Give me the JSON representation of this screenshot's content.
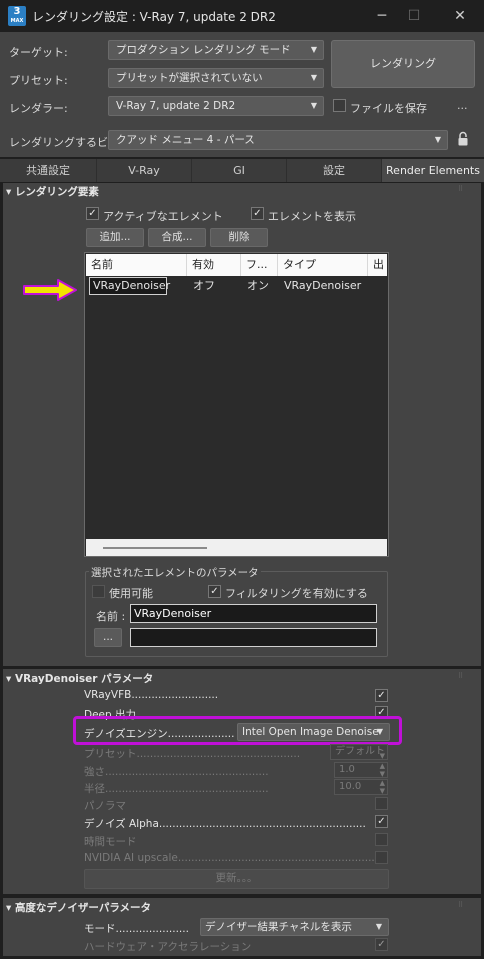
{
  "window": {
    "app_icon_text": "3",
    "app_icon_sub": "MAX",
    "title": "レンダリング設定 : V-Ray 7, update 2 DR2",
    "minimize": "─",
    "maximize": "☐",
    "close": "✕"
  },
  "top": {
    "target_label": "ターゲット:",
    "target_value": "プロダクション レンダリング モード",
    "preset_label": "プリセット:",
    "preset_value": "プリセットが選択されていない",
    "renderer_label": "レンダラー:",
    "renderer_value": "V-Ray 7, update 2 DR2",
    "render_button": "レンダリング",
    "save_file_label": "ファイルを保存",
    "save_file_checked": false,
    "more_button": "...",
    "view_label": "レンダリングするビュー:",
    "view_value": "クアッド メニュー 4 - パース"
  },
  "tabs": [
    "共通設定",
    "V-Ray",
    "GI",
    "設定",
    "Render Elements"
  ],
  "active_tab": "Render Elements",
  "render_elements": {
    "header": "レンダリング要素",
    "active_elements_label": "アクティブなエレメント",
    "active_elements_checked": true,
    "show_elements_label": "エレメントを表示",
    "show_elements_checked": true,
    "add_button": "追加...",
    "merge_button": "合成...",
    "delete_button": "削除",
    "columns": [
      "名前",
      "有効",
      "フ...",
      "タイプ",
      "出"
    ],
    "rows": [
      {
        "name": "VRayDenoiser",
        "enabled": "オフ",
        "filter": "オン",
        "type": "VRayDenoiser"
      }
    ],
    "selected_params": {
      "title": "選択されたエレメントのパラメータ",
      "enable_label": "使用可能",
      "enable_checked": false,
      "filtering_label": "フィルタリングを有効にする",
      "filtering_checked": true,
      "name_label": "名前 :",
      "name_value": "VRayDenoiser",
      "browse_button": "...",
      "path_value": ""
    }
  },
  "denoiser": {
    "header": "VRayDenoiser パラメータ",
    "vrayvfb_label": "VRayVFB..........................",
    "vrayvfb_checked": true,
    "deep_output_label": "Deep 出力",
    "deep_output_checked": true,
    "engine_label": "デノイズエンジン.........................",
    "engine_value": "Intel Open Image Denoise",
    "preset_label": "プリセット.................................................",
    "preset_value": "デフォルト",
    "strength_label": "強さ.................................................",
    "strength_value": "1.0",
    "radius_label": "半径.................................................",
    "radius_value": "10.0",
    "panorama_label": "パノラマ",
    "panorama_checked": false,
    "denoise_alpha_label": "デノイズ Alpha..............................................................",
    "denoise_alpha_checked": true,
    "time_mode_label": "時間モード",
    "time_mode_checked": false,
    "nvidia_label": "NVIDIA AI upscale...........................................................",
    "nvidia_checked": false,
    "update_button": "更新。。。"
  },
  "advanced": {
    "header": "高度なデノイザーパラメータ",
    "mode_label": "モード......................",
    "mode_value": "デノイザー結果チャネルを表示",
    "hw_accel_label": "ハードウェア・アクセラレーション",
    "hw_accel_checked": true
  },
  "annotations": {
    "arrow_color": "#f2e200",
    "arrow_outline": "#c010d8",
    "highlight_color": "#c010d8"
  }
}
